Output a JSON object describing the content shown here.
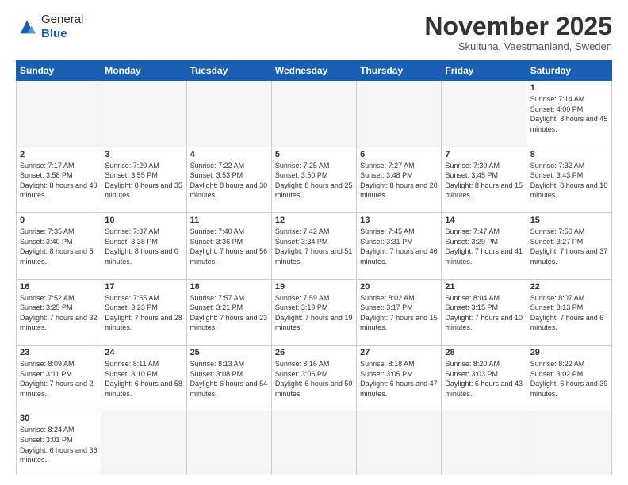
{
  "header": {
    "logo_general": "General",
    "logo_blue": "Blue",
    "month_title": "November 2025",
    "subtitle": "Skultuna, Vaestmanland, Sweden"
  },
  "weekdays": [
    "Sunday",
    "Monday",
    "Tuesday",
    "Wednesday",
    "Thursday",
    "Friday",
    "Saturday"
  ],
  "days": [
    {
      "date": "",
      "empty": true
    },
    {
      "date": "",
      "empty": true
    },
    {
      "date": "",
      "empty": true
    },
    {
      "date": "",
      "empty": true
    },
    {
      "date": "",
      "empty": true
    },
    {
      "date": "",
      "empty": true
    },
    {
      "date": "1",
      "sunrise": "7:14 AM",
      "sunset": "4:00 PM",
      "daylight": "8 hours and 45 minutes."
    },
    {
      "date": "2",
      "sunrise": "7:17 AM",
      "sunset": "3:58 PM",
      "daylight": "8 hours and 40 minutes."
    },
    {
      "date": "3",
      "sunrise": "7:20 AM",
      "sunset": "3:55 PM",
      "daylight": "8 hours and 35 minutes."
    },
    {
      "date": "4",
      "sunrise": "7:22 AM",
      "sunset": "3:53 PM",
      "daylight": "8 hours and 30 minutes."
    },
    {
      "date": "5",
      "sunrise": "7:25 AM",
      "sunset": "3:50 PM",
      "daylight": "8 hours and 25 minutes."
    },
    {
      "date": "6",
      "sunrise": "7:27 AM",
      "sunset": "3:48 PM",
      "daylight": "8 hours and 20 minutes."
    },
    {
      "date": "7",
      "sunrise": "7:30 AM",
      "sunset": "3:45 PM",
      "daylight": "8 hours and 15 minutes."
    },
    {
      "date": "8",
      "sunrise": "7:32 AM",
      "sunset": "3:43 PM",
      "daylight": "8 hours and 10 minutes."
    },
    {
      "date": "9",
      "sunrise": "7:35 AM",
      "sunset": "3:40 PM",
      "daylight": "8 hours and 5 minutes."
    },
    {
      "date": "10",
      "sunrise": "7:37 AM",
      "sunset": "3:38 PM",
      "daylight": "8 hours and 0 minutes."
    },
    {
      "date": "11",
      "sunrise": "7:40 AM",
      "sunset": "3:36 PM",
      "daylight": "7 hours and 56 minutes."
    },
    {
      "date": "12",
      "sunrise": "7:42 AM",
      "sunset": "3:34 PM",
      "daylight": "7 hours and 51 minutes."
    },
    {
      "date": "13",
      "sunrise": "7:45 AM",
      "sunset": "3:31 PM",
      "daylight": "7 hours and 46 minutes."
    },
    {
      "date": "14",
      "sunrise": "7:47 AM",
      "sunset": "3:29 PM",
      "daylight": "7 hours and 41 minutes."
    },
    {
      "date": "15",
      "sunrise": "7:50 AM",
      "sunset": "3:27 PM",
      "daylight": "7 hours and 37 minutes."
    },
    {
      "date": "16",
      "sunrise": "7:52 AM",
      "sunset": "3:25 PM",
      "daylight": "7 hours and 32 minutes."
    },
    {
      "date": "17",
      "sunrise": "7:55 AM",
      "sunset": "3:23 PM",
      "daylight": "7 hours and 28 minutes."
    },
    {
      "date": "18",
      "sunrise": "7:57 AM",
      "sunset": "3:21 PM",
      "daylight": "7 hours and 23 minutes."
    },
    {
      "date": "19",
      "sunrise": "7:59 AM",
      "sunset": "3:19 PM",
      "daylight": "7 hours and 19 minutes."
    },
    {
      "date": "20",
      "sunrise": "8:02 AM",
      "sunset": "3:17 PM",
      "daylight": "7 hours and 15 minutes."
    },
    {
      "date": "21",
      "sunrise": "8:04 AM",
      "sunset": "3:15 PM",
      "daylight": "7 hours and 10 minutes."
    },
    {
      "date": "22",
      "sunrise": "8:07 AM",
      "sunset": "3:13 PM",
      "daylight": "7 hours and 6 minutes."
    },
    {
      "date": "23",
      "sunrise": "8:09 AM",
      "sunset": "3:11 PM",
      "daylight": "7 hours and 2 minutes."
    },
    {
      "date": "24",
      "sunrise": "8:11 AM",
      "sunset": "3:10 PM",
      "daylight": "6 hours and 58 minutes."
    },
    {
      "date": "25",
      "sunrise": "8:13 AM",
      "sunset": "3:08 PM",
      "daylight": "6 hours and 54 minutes."
    },
    {
      "date": "26",
      "sunrise": "8:16 AM",
      "sunset": "3:06 PM",
      "daylight": "6 hours and 50 minutes."
    },
    {
      "date": "27",
      "sunrise": "8:18 AM",
      "sunset": "3:05 PM",
      "daylight": "6 hours and 47 minutes."
    },
    {
      "date": "28",
      "sunrise": "8:20 AM",
      "sunset": "3:03 PM",
      "daylight": "6 hours and 43 minutes."
    },
    {
      "date": "29",
      "sunrise": "8:22 AM",
      "sunset": "3:02 PM",
      "daylight": "6 hours and 39 minutes."
    },
    {
      "date": "30",
      "sunrise": "8:24 AM",
      "sunset": "3:01 PM",
      "daylight": "6 hours and 36 minutes."
    }
  ]
}
